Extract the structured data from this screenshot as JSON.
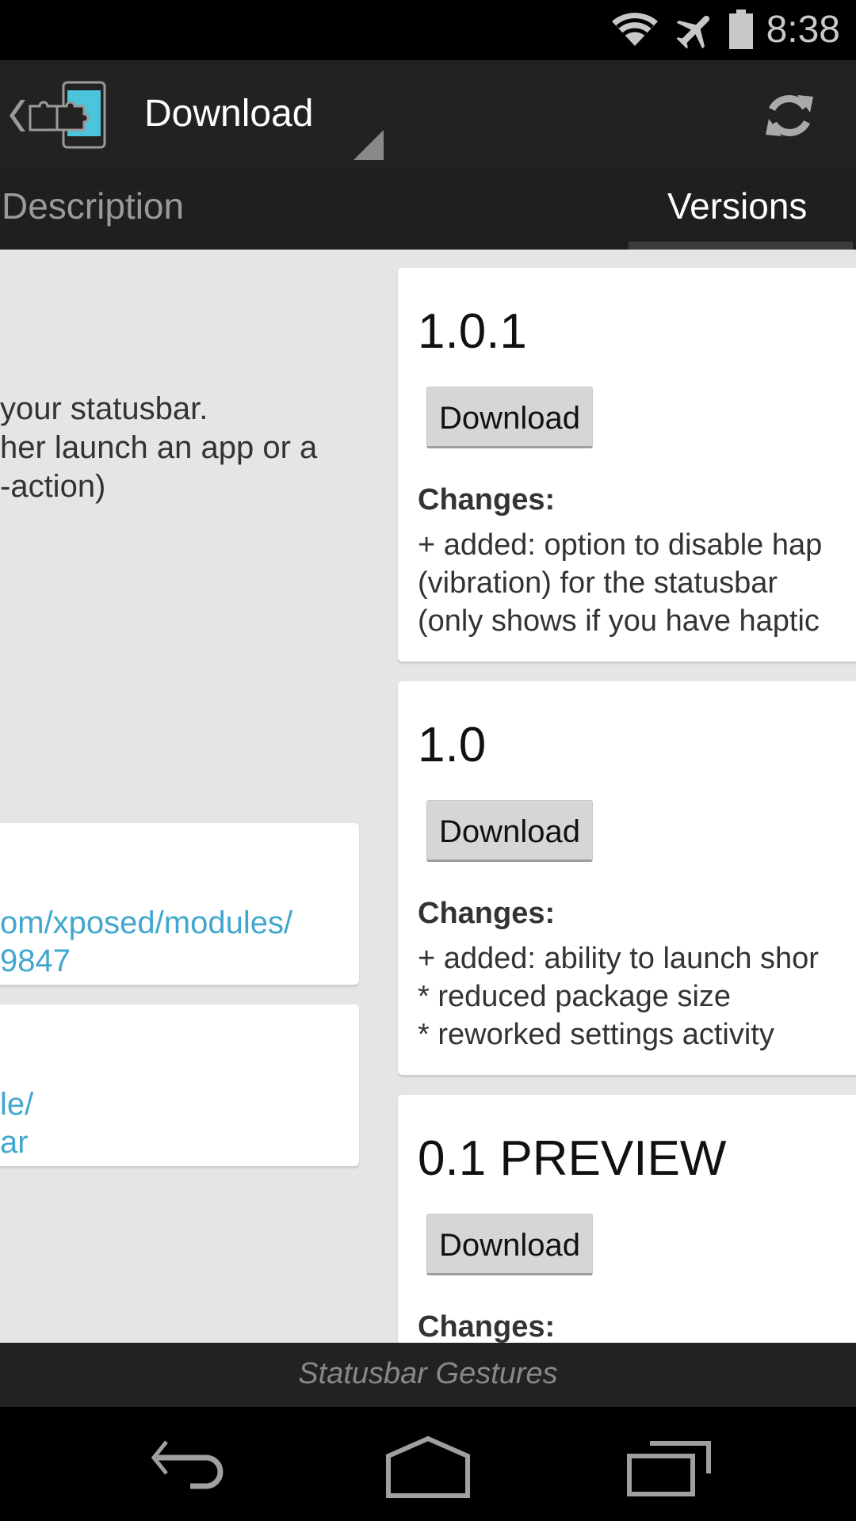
{
  "status_bar": {
    "time": "8:38",
    "icons": [
      "wifi-icon",
      "airplane-mode-icon",
      "battery-icon"
    ]
  },
  "action_bar": {
    "app_icon": "xposed-installer-icon",
    "title": "Download",
    "refresh_icon": "refresh-icon"
  },
  "tabs": [
    {
      "label": "Description",
      "selected": false
    },
    {
      "label": "Versions",
      "selected": true
    }
  ],
  "description_panel": {
    "lines": [
      " your statusbar.",
      "her launch an app or a",
      "-action)"
    ],
    "link_cards": [
      {
        "lines": [
          "om/xposed/modules/",
          "9847"
        ]
      },
      {
        "lines": [
          "le/",
          "ar"
        ]
      }
    ]
  },
  "versions": [
    {
      "name": "1.0.1",
      "download_label": "Download",
      "changes_label": "Changes:",
      "changes": [
        "+ added: option to disable hap",
        "(vibration) for the statusbar",
        "(only shows if you have haptic"
      ]
    },
    {
      "name": "1.0",
      "download_label": "Download",
      "changes_label": "Changes:",
      "changes": [
        "+ added: ability to launch shor",
        "* reduced package size",
        "* reworked settings activity"
      ]
    },
    {
      "name": "0.1 PREVIEW",
      "download_label": "Download",
      "changes_label": "Changes:",
      "changes": []
    }
  ],
  "footer": {
    "module_name": "Statusbar Gestures"
  },
  "nav_bar": {
    "buttons": [
      "back-icon",
      "home-icon",
      "recents-icon"
    ]
  },
  "colors": {
    "link": "#42a7cf",
    "app_icon_accent": "#4bc4dc",
    "action_bar": "#222222",
    "content_bg": "#e5e5e5"
  }
}
